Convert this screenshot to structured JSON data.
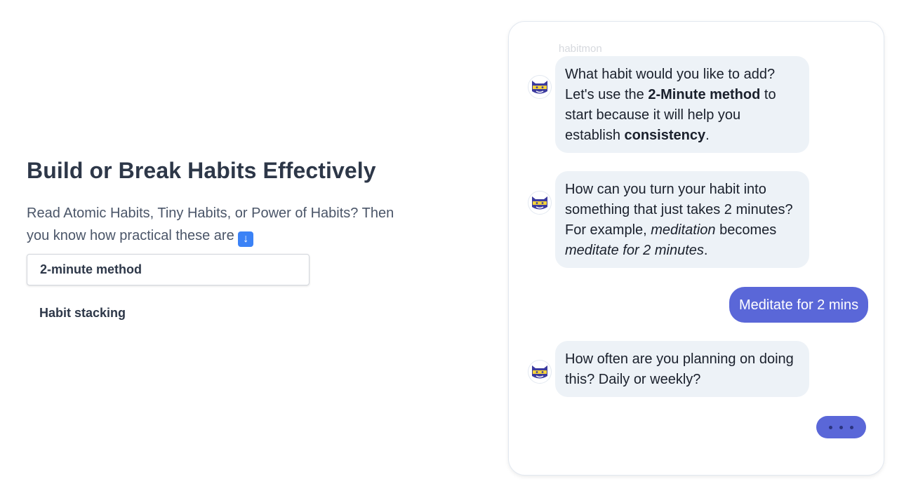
{
  "hero": {
    "headline": "Build or Break Habits Effectively",
    "lede_text": "Read Atomic Habits, Tiny Habits, or Power of Habits? Then you know how practical these are",
    "lede_emoji": "arrow-down-emoji"
  },
  "tabs": [
    {
      "label": "2-minute method",
      "active": true
    },
    {
      "label": "Habit stacking",
      "active": false
    }
  ],
  "chat": {
    "bot_name": "habitmon",
    "messages": [
      {
        "from": "bot",
        "parts": [
          "What habit would you like to add? Let's use the ",
          "2-Minute method",
          " to start because it will help you establish ",
          "consistency",
          "."
        ]
      },
      {
        "from": "bot",
        "parts": [
          "How can you turn your habit into something that just takes 2 minutes? For example, ",
          "meditation",
          " becomes ",
          "meditate for 2 minutes",
          "."
        ]
      },
      {
        "from": "user",
        "text": "Meditate for 2 mins"
      },
      {
        "from": "bot",
        "text": "How often are you planning on doing this? Daily or weekly?"
      }
    ],
    "typing_indicator": "user-typing"
  },
  "colors": {
    "accent": "#5a67d8",
    "bot_bubble": "#edf2f7",
    "heading": "#2d3748"
  }
}
